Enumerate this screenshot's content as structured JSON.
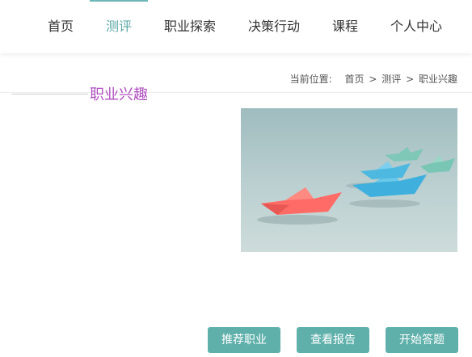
{
  "nav": {
    "items": [
      {
        "label": "首页"
      },
      {
        "label": "测评"
      },
      {
        "label": "职业探索"
      },
      {
        "label": "决策行动"
      },
      {
        "label": "课程"
      },
      {
        "label": "个人中心"
      }
    ],
    "active": "测评"
  },
  "breadcrumb": {
    "label": "当前位置:",
    "items": [
      "首页",
      ">",
      "测评",
      ">",
      "职业兴趣"
    ]
  },
  "section": {
    "title": "职业兴趣"
  },
  "image": {
    "subject": "paper-boats-image"
  },
  "actions": {
    "recommend_label": "推荐职业",
    "report_label": "查看报告",
    "start_label": "开始答题"
  },
  "colors": {
    "accent": "#5fb0ab",
    "title": "#b04fc0",
    "nav_active": "#5aa8a6"
  }
}
